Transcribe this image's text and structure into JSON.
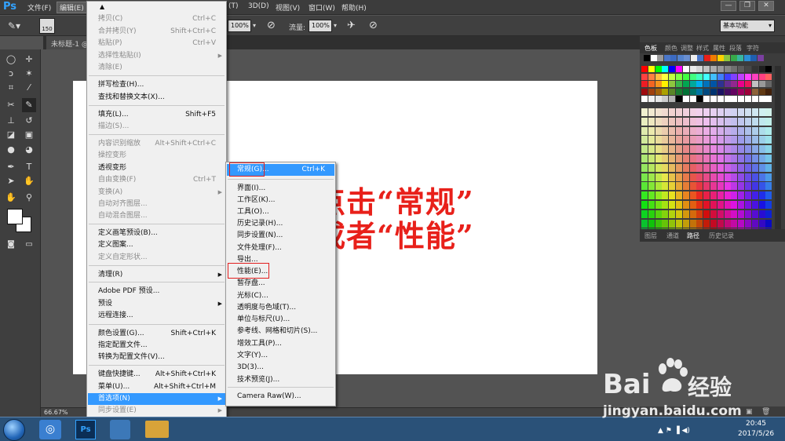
{
  "app": {
    "logo": "Ps",
    "zoom": "66.67%"
  },
  "menubar": {
    "items": [
      "文件(F)",
      "编辑(E)",
      "(T)",
      "3D(D)",
      "视图(V)",
      "窗口(W)",
      "帮助(H)"
    ]
  },
  "window_controls": [
    "—",
    "❐",
    "✕"
  ],
  "options_bar": {
    "brush_size": "150",
    "opacity_value": "100%",
    "flow_label": "流量:",
    "flow_value": "100%",
    "workspace": "基本功能"
  },
  "doc_tab": "未标题-1 @",
  "edit_menu": [
    {
      "label": "拷贝(C)",
      "shortcut": "Ctrl+C",
      "disabled": true
    },
    {
      "label": "合并拷贝(Y)",
      "shortcut": "Shift+Ctrl+C",
      "disabled": true
    },
    {
      "label": "粘贴(P)",
      "shortcut": "Ctrl+V",
      "disabled": true
    },
    {
      "label": "选择性粘贴(I)",
      "disabled": true,
      "submenu": true
    },
    {
      "label": "清除(E)",
      "disabled": true
    },
    {
      "label": "拼写检查(H)...",
      "disabled": false
    },
    {
      "label": "查找和替换文本(X)...",
      "disabled": false
    },
    {
      "label": "填充(L)...",
      "shortcut": "Shift+F5",
      "disabled": false
    },
    {
      "label": "描边(S)...",
      "disabled": true
    },
    {
      "label": "内容识别缩放",
      "shortcut": "Alt+Shift+Ctrl+C",
      "disabled": true
    },
    {
      "label": "操控变形",
      "disabled": true
    },
    {
      "label": "透视变形",
      "disabled": false
    },
    {
      "label": "自由变换(F)",
      "shortcut": "Ctrl+T",
      "disabled": true
    },
    {
      "label": "变换(A)",
      "disabled": true,
      "submenu": true
    },
    {
      "label": "自动对齐图层...",
      "disabled": true
    },
    {
      "label": "自动混合图层...",
      "disabled": true
    },
    {
      "label": "定义画笔预设(B)...",
      "disabled": false
    },
    {
      "label": "定义图案...",
      "disabled": false
    },
    {
      "label": "定义自定形状...",
      "disabled": true
    },
    {
      "label": "清理(R)",
      "disabled": false,
      "submenu": true
    },
    {
      "label": "Adobe PDF 预设...",
      "disabled": false
    },
    {
      "label": "预设",
      "disabled": false,
      "submenu": true
    },
    {
      "label": "远程连接...",
      "disabled": false
    },
    {
      "label": "颜色设置(G)...",
      "shortcut": "Shift+Ctrl+K",
      "disabled": false
    },
    {
      "label": "指定配置文件...",
      "disabled": false
    },
    {
      "label": "转换为配置文件(V)...",
      "disabled": false
    },
    {
      "label": "键盘快捷键...",
      "shortcut": "Alt+Shift+Ctrl+K",
      "disabled": false
    },
    {
      "label": "菜单(U)...",
      "shortcut": "Alt+Shift+Ctrl+M",
      "disabled": false
    },
    {
      "label": "首选项(N)",
      "disabled": false,
      "submenu": true,
      "highlighted": true
    },
    {
      "label": "同步设置(E)",
      "disabled": true,
      "submenu": true
    }
  ],
  "prefs_menu": [
    {
      "label": "常规(G)...",
      "shortcut": "Ctrl+K",
      "highlighted": true
    },
    {
      "label": "界面(I)..."
    },
    {
      "label": "工作区(K)..."
    },
    {
      "label": "工具(O)..."
    },
    {
      "label": "历史记录(H)..."
    },
    {
      "label": "同步设置(N)..."
    },
    {
      "label": "文件处理(F)..."
    },
    {
      "label": "导出..."
    },
    {
      "label": "性能(E)..."
    },
    {
      "label": "暂存盘..."
    },
    {
      "label": "光标(C)..."
    },
    {
      "label": "透明度与色域(T)..."
    },
    {
      "label": "单位与标尺(U)..."
    },
    {
      "label": "参考线、网格和切片(S)..."
    },
    {
      "label": "增效工具(P)..."
    },
    {
      "label": "文字(Y)..."
    },
    {
      "label": "3D(3)..."
    },
    {
      "label": "技术预览(J)..."
    },
    {
      "label": "Camera Raw(W)..."
    }
  ],
  "annotation": {
    "line1": "点击“常规”",
    "line2": "或者“性能”"
  },
  "right_panel": {
    "top_tabs": [
      "色板",
      "颜色",
      "调整",
      "样式",
      "属性",
      "段落",
      "字符"
    ],
    "bottom_tabs": [
      "图层",
      "通道",
      "路径",
      "历史记录"
    ]
  },
  "taskbar": {
    "time": "20:45",
    "date": "2017/5/26"
  },
  "watermark": {
    "brand": "Bai",
    "brand2": "经验",
    "url": "jingyan.baidu.com"
  },
  "colors": {
    "menu_highlight": "#3399ff",
    "annotation_red": "#e8201a",
    "ps_blue": "#32a2ff"
  }
}
